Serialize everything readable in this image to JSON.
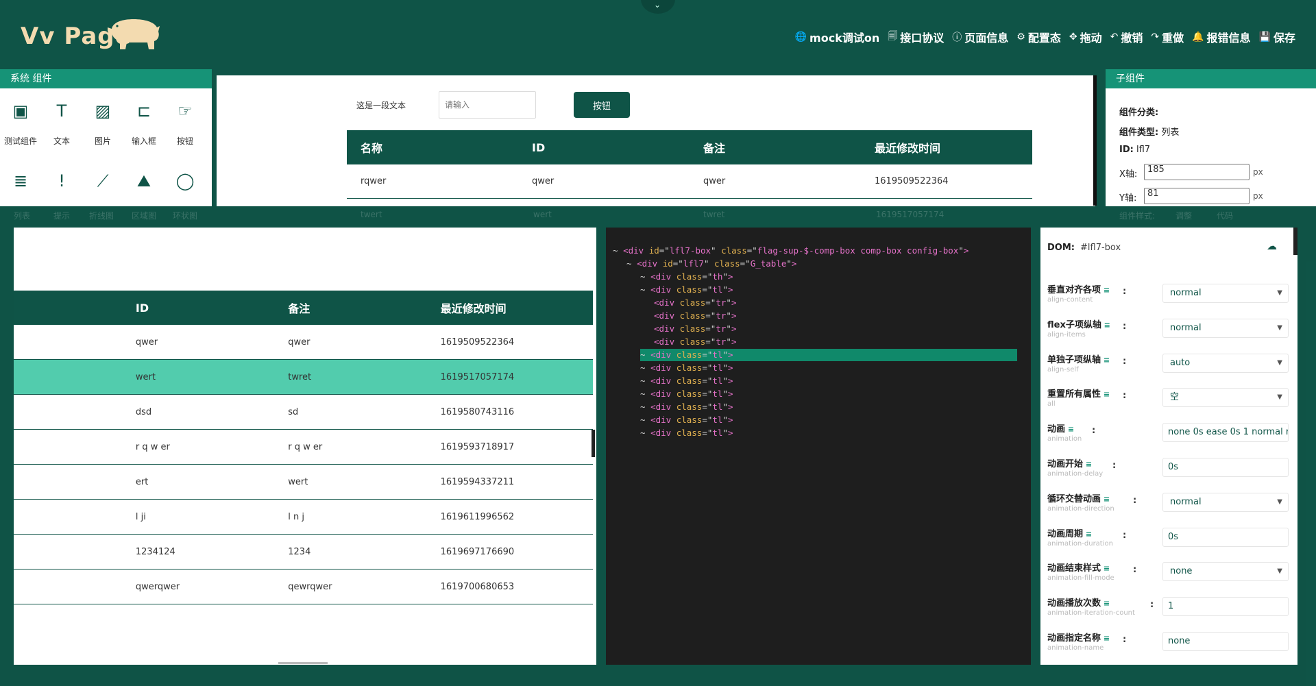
{
  "header": {
    "logo": "Vv Page",
    "toolbar": [
      {
        "icon": "🌐",
        "label": "mock调试on"
      },
      {
        "icon": "🗐",
        "label": "接口协议"
      },
      {
        "icon": "ⓘ",
        "label": "页面信息"
      },
      {
        "icon": "⚙",
        "label": "配置态"
      },
      {
        "icon": "✥",
        "label": "拖动"
      },
      {
        "icon": "↶",
        "label": "撤销"
      },
      {
        "icon": "↷",
        "label": "重做"
      },
      {
        "icon": "🔔",
        "label": "报错信息"
      },
      {
        "icon": "💾",
        "label": "保存"
      }
    ]
  },
  "left": {
    "title": "系统 组件",
    "components": [
      {
        "icon": "▣",
        "label": "测试组件"
      },
      {
        "icon": "T",
        "label": "文本"
      },
      {
        "icon": "▨",
        "label": "图片"
      },
      {
        "icon": "⊏",
        "label": "输入框"
      },
      {
        "icon": "☞",
        "label": "按钮"
      },
      {
        "icon": "≣",
        "label": "列表"
      },
      {
        "icon": "!",
        "label": "提示"
      },
      {
        "icon": "⟋",
        "label": "折线图"
      },
      {
        "icon": "⛰",
        "label": "区域图"
      },
      {
        "icon": "◯",
        "label": "环状图"
      }
    ]
  },
  "canvas": {
    "text": "这是一段文本",
    "input_placeholder": "请输入",
    "button": "按钮",
    "table": {
      "headers": [
        "名称",
        "ID",
        "备注",
        "最近修改时间"
      ],
      "rows": [
        [
          "rqwer",
          "qwer",
          "qwer",
          "1619509522364"
        ],
        [
          "twert",
          "wert",
          "twret",
          "1619517057174"
        ]
      ]
    }
  },
  "right": {
    "title": "子组件",
    "category_label": "组件分类:",
    "category_value": "",
    "type_label": "组件类型:",
    "type_value": "列表",
    "id_label": "ID:",
    "id_value": "lfl7",
    "x_label": "X轴:",
    "x_value": "185",
    "y_label": "Y轴:",
    "y_value": "81",
    "unit": "px",
    "style_label": "组件样式:",
    "tab1": "调整",
    "tab2": "代码"
  },
  "table_panel": {
    "headers": [
      "ID",
      "备注",
      "最近修改时间"
    ],
    "rows": [
      [
        "qwer",
        "qwer",
        "1619509522364"
      ],
      [
        "wert",
        "twret",
        "1619517057174"
      ],
      [
        "dsd",
        "sd",
        "1619580743116"
      ],
      [
        "r q w er",
        "r q w er",
        "1619593718917"
      ],
      [
        "ert",
        "wert",
        "1619594337211"
      ],
      [
        "l ji",
        "l n j",
        "1619611996562"
      ],
      [
        "1234124",
        "1234",
        "1619697176690"
      ],
      [
        "qwerqwer",
        "qewrqwer",
        "1619700680653"
      ]
    ],
    "selected_index": 1
  },
  "code": {
    "lines": [
      {
        "indent": 0,
        "toggle": "~",
        "tag": "div",
        "attrs": [
          [
            "id",
            "lfl7-box"
          ],
          [
            "class",
            "flag-sup-$-comp-box comp-box config-box"
          ]
        ]
      },
      {
        "indent": 1,
        "toggle": "~",
        "tag": "div",
        "attrs": [
          [
            "id",
            "lfl7"
          ],
          [
            "class",
            "G_table"
          ]
        ]
      },
      {
        "indent": 2,
        "toggle": "~",
        "tag": "div",
        "attrs": [
          [
            "class",
            "th"
          ]
        ]
      },
      {
        "indent": 2,
        "toggle": "~",
        "tag": "div",
        "attrs": [
          [
            "class",
            "tl"
          ]
        ]
      },
      {
        "indent": 3,
        "toggle": "",
        "tag": "div",
        "attrs": [
          [
            "class",
            "tr"
          ]
        ]
      },
      {
        "indent": 3,
        "toggle": "",
        "tag": "div",
        "attrs": [
          [
            "class",
            "tr"
          ]
        ]
      },
      {
        "indent": 3,
        "toggle": "",
        "tag": "div",
        "attrs": [
          [
            "class",
            "tr"
          ]
        ]
      },
      {
        "indent": 3,
        "toggle": "",
        "tag": "div",
        "attrs": [
          [
            "class",
            "tr"
          ]
        ]
      },
      {
        "indent": 2,
        "toggle": "~",
        "tag": "div",
        "attrs": [
          [
            "class",
            "tl"
          ]
        ],
        "highlight": true
      },
      {
        "indent": 2,
        "toggle": "~",
        "tag": "div",
        "attrs": [
          [
            "class",
            "tl"
          ]
        ]
      },
      {
        "indent": 2,
        "toggle": "~",
        "tag": "div",
        "attrs": [
          [
            "class",
            "tl"
          ]
        ]
      },
      {
        "indent": 2,
        "toggle": "~",
        "tag": "div",
        "attrs": [
          [
            "class",
            "tl"
          ]
        ]
      },
      {
        "indent": 2,
        "toggle": "~",
        "tag": "div",
        "attrs": [
          [
            "class",
            "tl"
          ]
        ]
      },
      {
        "indent": 2,
        "toggle": "~",
        "tag": "div",
        "attrs": [
          [
            "class",
            "tl"
          ]
        ]
      },
      {
        "indent": 2,
        "toggle": "~",
        "tag": "div",
        "attrs": [
          [
            "class",
            "tl"
          ]
        ]
      }
    ]
  },
  "style_panel": {
    "dom_label": "DOM:",
    "dom_value": "#lfl7-box",
    "props": [
      {
        "name": "垂直对齐各项",
        "en": "align-content",
        "value": "normal",
        "kind": "select"
      },
      {
        "name": "flex子项纵轴",
        "en": "align-items",
        "value": "normal",
        "kind": "select"
      },
      {
        "name": "单独子项纵轴",
        "en": "align-self",
        "value": "auto",
        "kind": "select"
      },
      {
        "name": "重置所有属性",
        "en": "all",
        "value": "空",
        "kind": "select"
      },
      {
        "name": "动画",
        "en": "animation",
        "value": "none 0s ease 0s 1 normal r",
        "kind": "input"
      },
      {
        "name": "动画开始",
        "en": "animation-delay",
        "value": "0s",
        "kind": "input"
      },
      {
        "name": "循环交替动画",
        "en": "animation-direction",
        "value": "normal",
        "kind": "select"
      },
      {
        "name": "动画周期",
        "en": "animation-duration",
        "value": "0s",
        "kind": "input"
      },
      {
        "name": "动画结束样式",
        "en": "animation-fill-mode",
        "value": "none",
        "kind": "select"
      },
      {
        "name": "动画播放次数",
        "en": "animation-iteration-count",
        "value": "1",
        "kind": "input"
      },
      {
        "name": "动画指定名称",
        "en": "animation-name",
        "value": "none",
        "kind": "input"
      }
    ]
  },
  "colors": {
    "primary": "#0f5447",
    "accent": "#169377",
    "selected_row": "#52ccad",
    "logo": "#f3dbb0"
  }
}
